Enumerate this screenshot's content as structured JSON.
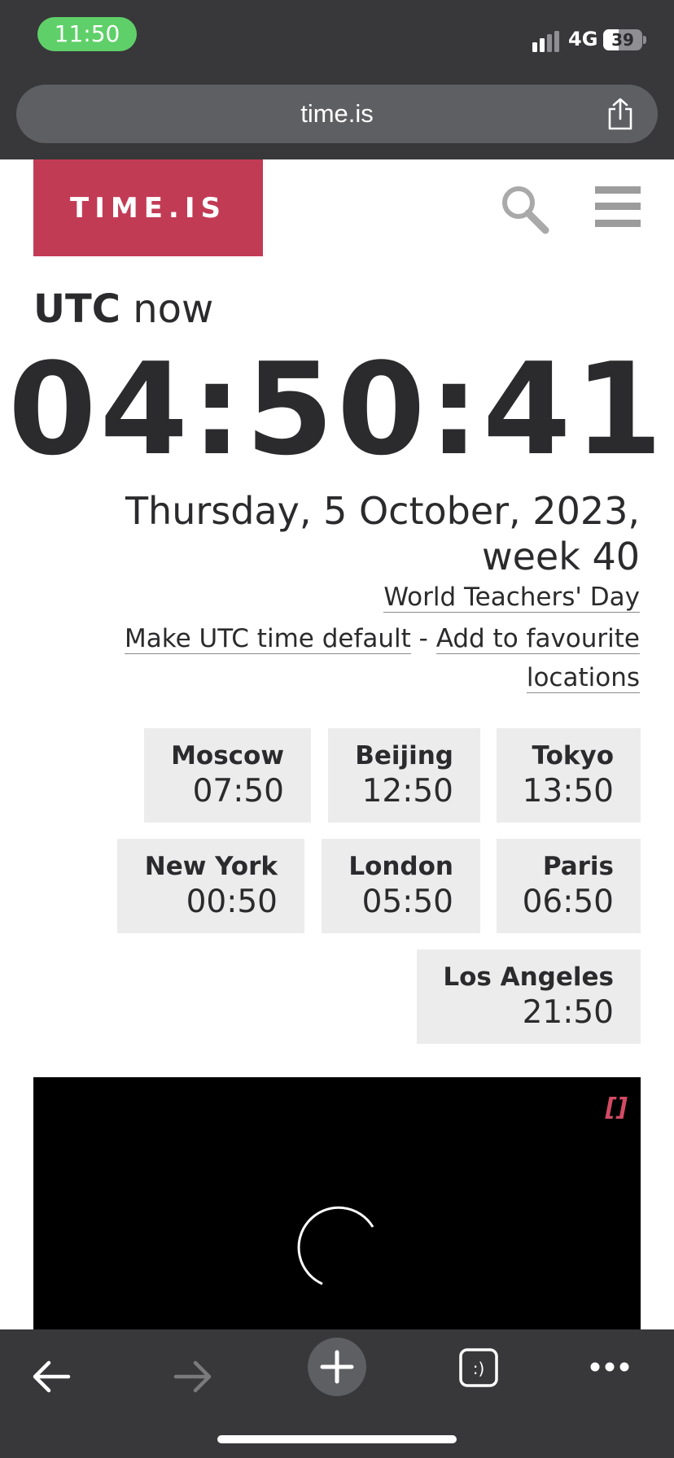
{
  "status_bar": {
    "time": "11:50",
    "network": "4G",
    "battery": "39",
    "battery_level": 0.39
  },
  "browser": {
    "url": "time.is"
  },
  "site": {
    "logo": "TIME.IS"
  },
  "zone": {
    "name": "UTC",
    "suffix": "now"
  },
  "clock": {
    "time": "04:50:41"
  },
  "date": {
    "line1": "Thursday, 5 October, 2023,",
    "line2": "week 40"
  },
  "holiday": "World Teachers' Day",
  "actions": {
    "make_default": "Make UTC time default",
    "separator": "-",
    "add_favourite": "Add to favourite locations"
  },
  "cities": [
    {
      "name": "Moscow",
      "time": "07:50"
    },
    {
      "name": "Beijing",
      "time": "12:50"
    },
    {
      "name": "Tokyo",
      "time": "13:50"
    },
    {
      "name": "New York",
      "time": "00:50"
    },
    {
      "name": "London",
      "time": "05:50"
    },
    {
      "name": "Paris",
      "time": "06:50"
    },
    {
      "name": "Los Angeles",
      "time": "21:50"
    }
  ],
  "video": {
    "fullscreen_glyph": "[]"
  },
  "colors": {
    "brand": "#c23b55",
    "chrome": "#38383a",
    "tile": "#ececec",
    "status_green": "#5fd069"
  },
  "icons": {
    "search": "search-icon",
    "menu": "hamburger-menu-icon",
    "share": "share-icon",
    "back": "back-arrow-icon",
    "forward": "forward-arrow-icon",
    "new_tab": "plus-icon",
    "tabs": "tabs-icon",
    "more": "more-dots-icon"
  }
}
